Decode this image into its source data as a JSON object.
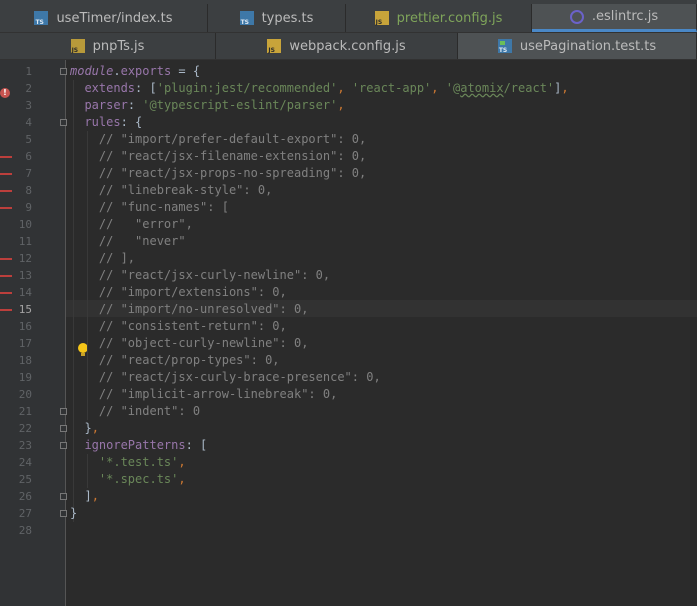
{
  "tabs_row1": [
    {
      "label": "useTimer/index.ts",
      "icon": "ts-file-icon",
      "active": false,
      "color": "#bbbbbb"
    },
    {
      "label": "types.ts",
      "icon": "ts-file-icon",
      "active": false,
      "color": "#bbbbbb"
    },
    {
      "label": "prettier.config.js",
      "icon": "js-file-icon",
      "active": false,
      "color": "#7fa55a"
    },
    {
      "label": ".eslintrc.js",
      "icon": "eslint-icon",
      "active": true,
      "color": "#bbbbbb"
    }
  ],
  "tabs_row2": [
    {
      "label": "pnpTs.js",
      "icon": "js-file-icon",
      "active": false
    },
    {
      "label": "webpack.config.js",
      "icon": "js-file-icon",
      "active": false
    },
    {
      "label": "usePagination.test.ts",
      "icon": "test-file-icon",
      "active": false
    }
  ],
  "editor": {
    "current_line": 15,
    "line_numbers": [
      "1",
      "2",
      "3",
      "4",
      "5",
      "6",
      "7",
      "8",
      "9",
      "10",
      "11",
      "12",
      "13",
      "14",
      "15",
      "16",
      "17",
      "18",
      "19",
      "20",
      "21",
      "22",
      "23",
      "24",
      "25",
      "26",
      "27",
      "28"
    ],
    "lines": [
      "module.exports = {",
      "  extends: ['plugin:jest/recommended', 'react-app', '@atomix/react'],",
      "  parser: '@typescript-eslint/parser',",
      "  rules: {",
      "    // \"import/prefer-default-export\": 0,",
      "    // \"react/jsx-filename-extension\": 0,",
      "    // \"react/jsx-props-no-spreading\": 0,",
      "    // \"linebreak-style\": 0,",
      "    // \"func-names\": [",
      "    //   \"error\",",
      "    //   \"never\"",
      "    // ],",
      "    // \"react/jsx-curly-newline\": 0,",
      "    // \"import/extensions\": 0,",
      "    // \"import/no-unresolved\": 0,",
      "    // \"consistent-return\": 0,",
      "    // \"object-curly-newline\": 0,",
      "    // \"react/prop-types\": 0,",
      "    // \"react/jsx-curly-brace-presence\": 0,",
      "    // \"implicit-arrow-linebreak\": 0,",
      "    // \"indent\": 0",
      "  },",
      "  ignorePatterns: [",
      "    '*.test.ts',",
      "    '*.spec.ts',",
      "  ],",
      "}",
      ""
    ],
    "error_count_badge": "!",
    "colors": {
      "background": "#2b2b2b",
      "keyword": "#cc7832",
      "string": "#6a8759",
      "property": "#9876aa",
      "comment": "#808080",
      "number": "#6897bb",
      "error_marker": "#bc3f3c"
    }
  }
}
